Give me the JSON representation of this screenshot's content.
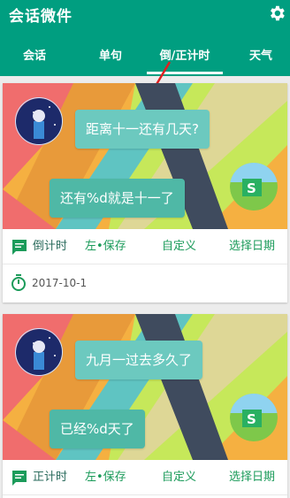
{
  "app": {
    "title": "会话微件",
    "settings_icon": "gear-icon"
  },
  "tabs": [
    {
      "label": "会话"
    },
    {
      "label": "单句"
    },
    {
      "label": "倒/正计时",
      "selected": true
    },
    {
      "label": "天气"
    }
  ],
  "colors": {
    "primary": "#009e80",
    "accent": "#1b9b5a",
    "bubble": "#6cc9bf",
    "arrow": "#e02020"
  },
  "cards": [
    {
      "question": "距离十一还有几天?",
      "answer": "还有%d就是十一了",
      "mode": "倒计时",
      "actions": [
        "左•保存",
        "自定义",
        "选择日期"
      ],
      "date": "2017-10-1"
    },
    {
      "question": "九月一过去多久了",
      "answer": "已经%d天了",
      "mode": "正计时",
      "actions": [
        "左•保存",
        "自定义",
        "选择日期"
      ]
    }
  ]
}
